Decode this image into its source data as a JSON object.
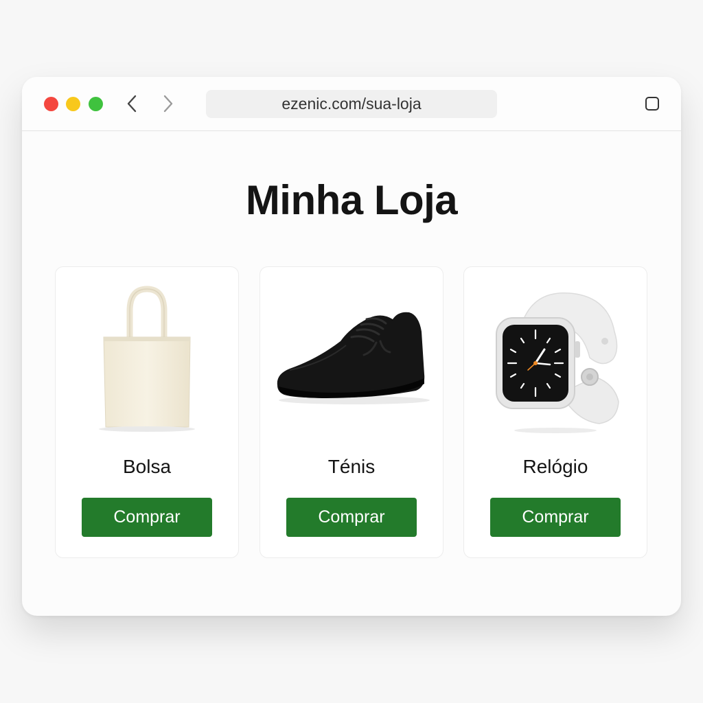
{
  "browser": {
    "url": "ezenic.com/sua-loja"
  },
  "page": {
    "title": "Minha Loja"
  },
  "products": [
    {
      "name": "Bolsa",
      "button_label": "Comprar",
      "icon": "tote-bag-icon"
    },
    {
      "name": "Ténis",
      "button_label": "Comprar",
      "icon": "sneaker-icon"
    },
    {
      "name": "Relógio",
      "button_label": "Comprar",
      "icon": "smartwatch-icon"
    }
  ],
  "colors": {
    "button": "#237b2b",
    "close_dot": "#f4473f",
    "minimize_dot": "#f8c81c",
    "maximize_dot": "#3fc23e"
  }
}
